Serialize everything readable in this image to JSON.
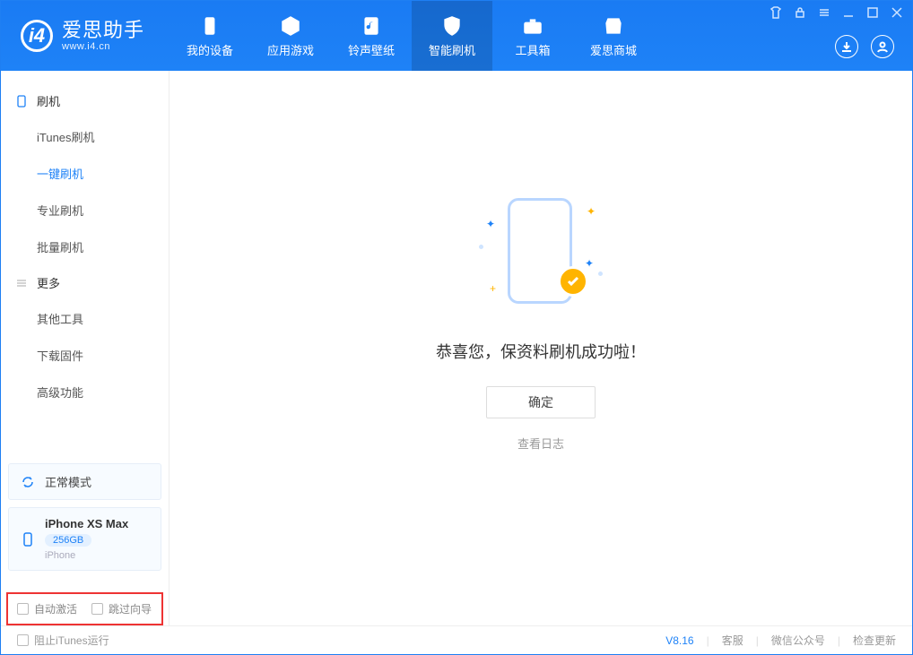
{
  "app": {
    "title": "爱思助手",
    "subtitle": "www.i4.cn"
  },
  "nav": {
    "items": [
      {
        "label": "我的设备"
      },
      {
        "label": "应用游戏"
      },
      {
        "label": "铃声壁纸"
      },
      {
        "label": "智能刷机"
      },
      {
        "label": "工具箱"
      },
      {
        "label": "爱思商城"
      }
    ],
    "activeIndex": 3
  },
  "sidebar": {
    "group1": {
      "title": "刷机"
    },
    "items1": [
      {
        "label": "iTunes刷机"
      },
      {
        "label": "一键刷机"
      },
      {
        "label": "专业刷机"
      },
      {
        "label": "批量刷机"
      }
    ],
    "activeIndex": 1,
    "group2": {
      "title": "更多"
    },
    "items2": [
      {
        "label": "其他工具"
      },
      {
        "label": "下载固件"
      },
      {
        "label": "高级功能"
      }
    ],
    "mode": {
      "label": "正常模式"
    },
    "device": {
      "name": "iPhone XS Max",
      "capacity": "256GB",
      "type": "iPhone"
    },
    "check1": "自动激活",
    "check2": "跳过向导"
  },
  "main": {
    "successText": "恭喜您，保资料刷机成功啦！",
    "okBtn": "确定",
    "viewLog": "查看日志"
  },
  "footer": {
    "blockItunes": "阻止iTunes运行",
    "version": "V8.16",
    "service": "客服",
    "wechat": "微信公众号",
    "update": "检查更新"
  }
}
